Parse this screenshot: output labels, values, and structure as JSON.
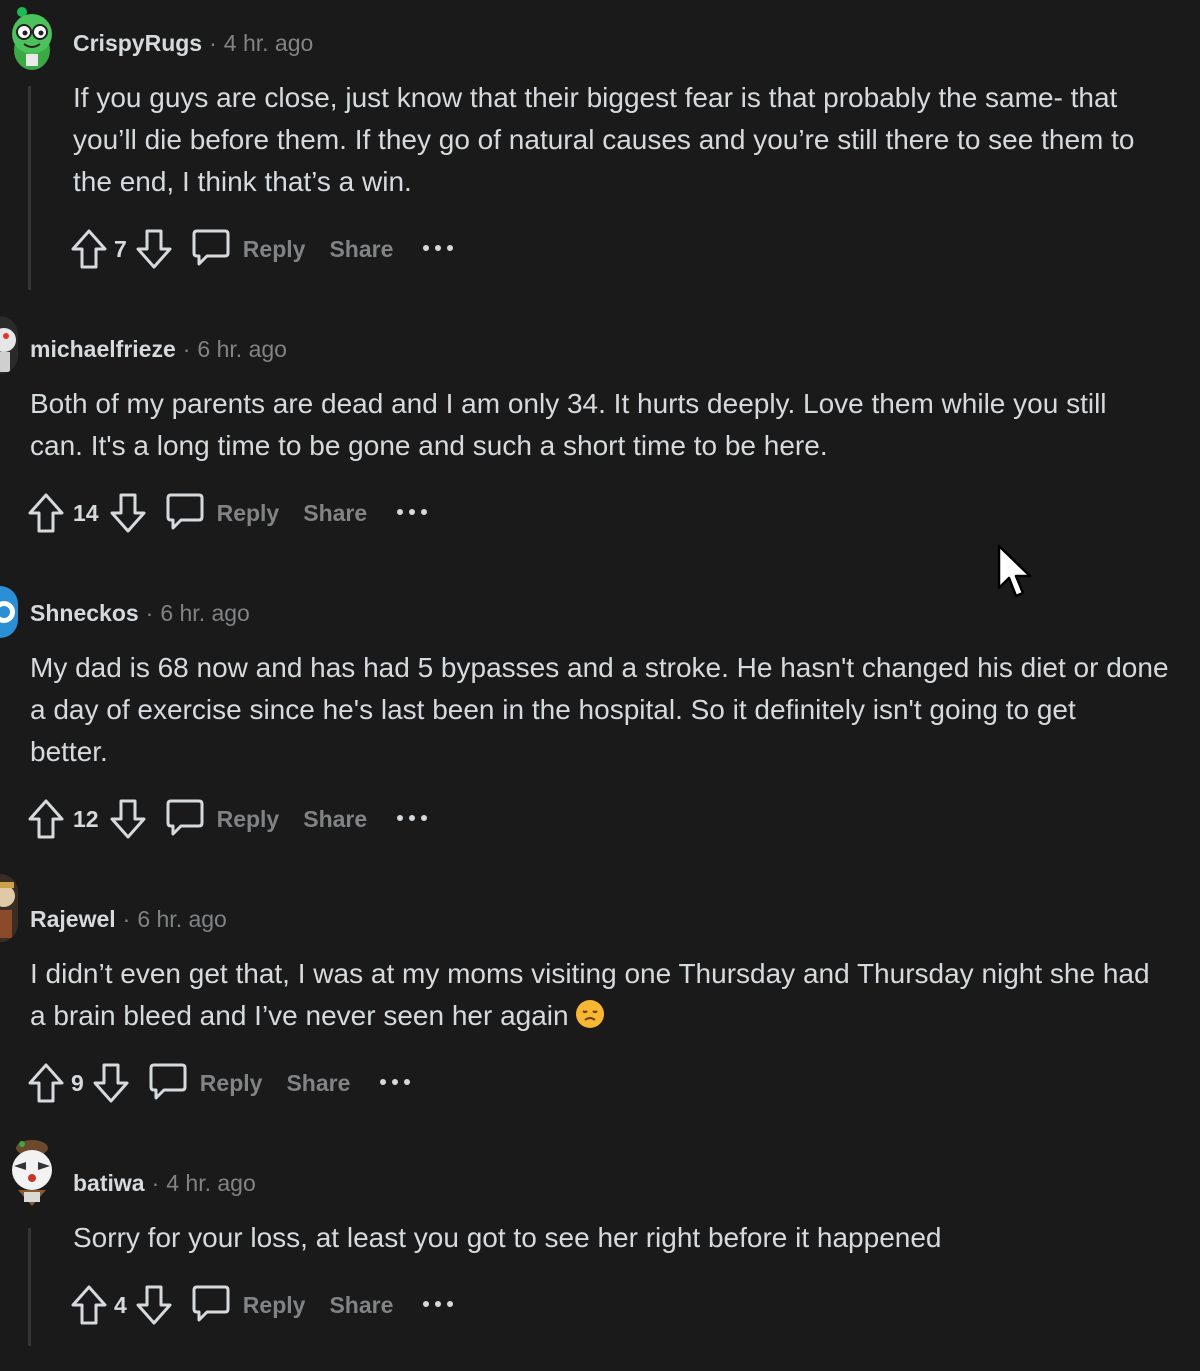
{
  "comments": [
    {
      "username": "CrispyRugs",
      "timestamp": "4 hr. ago",
      "body": [
        "If you guys are close, just know that their biggest fear is that probably the same- that",
        "you’ll die before them. If they go of natural causes and you’re still there to see them to",
        "the end, I think that’s a win."
      ],
      "votes": "7",
      "reply_label": "Reply",
      "share_label": "Share"
    },
    {
      "username": "michaelfrieze",
      "timestamp": "6 hr. ago",
      "body": [
        "Both of my parents are dead and I am only 34. It hurts deeply. Love them while you still",
        "can. It's a long time to be gone and such a short time to be here."
      ],
      "votes": "14",
      "reply_label": "Reply",
      "share_label": "Share"
    },
    {
      "username": "Shneckos",
      "timestamp": "6 hr. ago",
      "body": [
        "My dad is 68 now and has had 5 bypasses and a stroke. He hasn't changed his diet or done",
        "a day of exercise since he's last been in the hospital. So it definitely isn't going to get",
        "better."
      ],
      "votes": "12",
      "reply_label": "Reply",
      "share_label": "Share"
    },
    {
      "username": "Rajewel",
      "timestamp": "6 hr. ago",
      "body": [
        "I didn’t even get that, I was at my moms visiting one Thursday and Thursday night she had",
        "a brain bleed and I’ve never seen her again"
      ],
      "emoji": "disappointed-face-emoji",
      "votes": "9",
      "reply_label": "Reply",
      "share_label": "Share"
    },
    {
      "username": "batiwa",
      "timestamp": "4 hr. ago",
      "body": [
        "Sorry for your loss, at least you got to see her right before it happened"
      ],
      "votes": "4",
      "reply_label": "Reply",
      "share_label": "Share"
    }
  ],
  "separator": "·",
  "icons": {
    "upvote": "upvote-arrow-icon",
    "downvote": "downvote-arrow-icon",
    "reply": "comment-bubble-icon",
    "more": "more-options-icon",
    "pointer": "mouse-pointer-icon"
  },
  "colors": {
    "background": "#1a1a1b",
    "text": "#d7dadc",
    "meta": "#818384",
    "thread_line": "#343536"
  }
}
